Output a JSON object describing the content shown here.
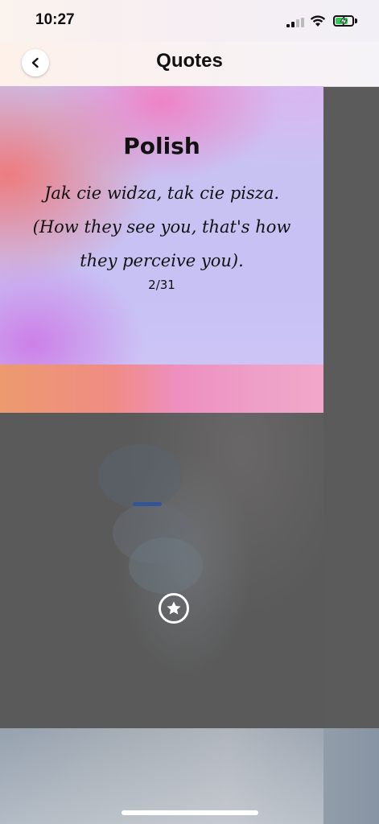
{
  "status_bar": {
    "time": "10:27",
    "icons": [
      "signal-icon",
      "wifi-icon",
      "battery-icon"
    ],
    "battery_color": "#34c759"
  },
  "nav": {
    "title": "Quotes",
    "back_icon": "chevron-left-icon"
  },
  "quote": {
    "language": "Polish",
    "text": "Jak cie widza, tak cie pisza. (How they see you, that's how they perceive you).",
    "counter": "2/31"
  },
  "favorite": {
    "icon": "star-icon"
  },
  "colors": {
    "overlay": "#5b5b5b",
    "card_band_start": "#ec9a6e",
    "card_band_end": "#f2a7c9",
    "card_base": "#c9c3f2"
  }
}
